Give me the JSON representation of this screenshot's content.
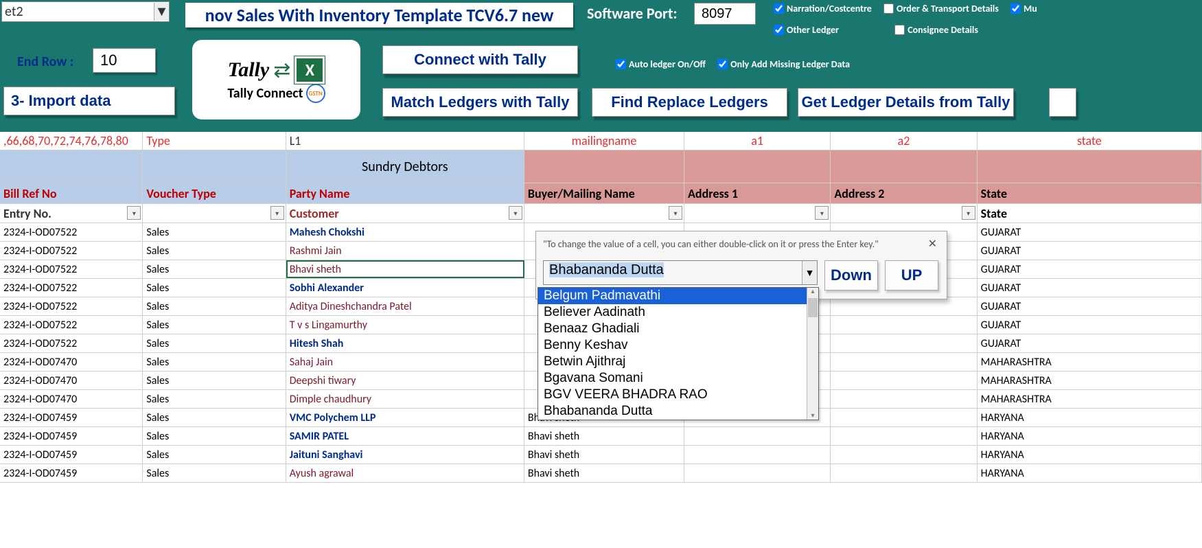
{
  "topCombo": "et2",
  "title": "nov Sales With Inventory Template TCV6.7 new",
  "softwarePortLabel": "Software Port:",
  "softwarePort": "8097",
  "checks": {
    "narration": {
      "label": "Narration/Costcentre",
      "checked": true
    },
    "order": {
      "label": "Order & Transport Details",
      "checked": false
    },
    "mu": {
      "label": "Mu",
      "checked": true
    },
    "otherLedger": {
      "label": "Other Ledger",
      "checked": true
    },
    "consignee": {
      "label": "Consignee Details",
      "checked": false
    },
    "autoLedger": {
      "label": "Auto ledger On/Off",
      "checked": true
    },
    "onlyAdd": {
      "label": "Only Add Missing Ledger Data",
      "checked": true
    }
  },
  "endRowLabel": "End Row :",
  "endRow": "10",
  "buttons": {
    "import": "3- Import data",
    "connect": "Connect  with Tally",
    "match": "Match Ledgers with Tally",
    "find": "Find Replace Ledgers",
    "getLedger": "Get Ledger Details from Tally"
  },
  "logo": {
    "l1": "Tally",
    "l2": "Tally Connect",
    "gst": "GSTN"
  },
  "headerRow1": {
    "colA": ",66,68,70,72,74,76,78,80",
    "colB": "Type",
    "colC": "L1",
    "colD": "mailingname",
    "colE": "a1",
    "colF": "a2",
    "colG": "state"
  },
  "headerRow2": {
    "colC": "Sundry Debtors"
  },
  "headerRow3": {
    "colA": "Bill Ref No",
    "colB": "Voucher Type",
    "colC": "Party Name",
    "colD": "Buyer/Mailing Name",
    "colE": "Address 1",
    "colF": "Address 2",
    "colG": "State"
  },
  "headerRow4": {
    "colA": "Entry No.",
    "colC": "Customer",
    "colG": "State"
  },
  "rows": [
    {
      "ref": "2324-I-OD07522",
      "vt": "Sales",
      "party": "Mahesh Chokshi",
      "style": "blue",
      "buyer": "",
      "state": "GUJARAT"
    },
    {
      "ref": "2324-I-OD07522",
      "vt": "Sales",
      "party": "Rashmi Jain",
      "style": "maroon",
      "buyer": "",
      "state": "GUJARAT"
    },
    {
      "ref": "2324-I-OD07522",
      "vt": "Sales",
      "party": "Bhavi sheth",
      "style": "maroon",
      "buyer": "",
      "state": "GUJARAT",
      "sel": true
    },
    {
      "ref": "2324-I-OD07522",
      "vt": "Sales",
      "party": "Sobhi Alexander",
      "style": "blue",
      "buyer": "",
      "state": "GUJARAT"
    },
    {
      "ref": "2324-I-OD07522",
      "vt": "Sales",
      "party": "Aditya Dineshchandra Patel",
      "style": "maroon",
      "buyer": "",
      "state": "GUJARAT"
    },
    {
      "ref": "2324-I-OD07522",
      "vt": "Sales",
      "party": "T v s Lingamurthy",
      "style": "maroon",
      "buyer": "",
      "state": "GUJARAT"
    },
    {
      "ref": "2324-I-OD07522",
      "vt": "Sales",
      "party": "Hitesh Shah",
      "style": "blue",
      "buyer": "",
      "state": "GUJARAT"
    },
    {
      "ref": "2324-I-OD07470",
      "vt": "Sales",
      "party": "Sahaj Jain",
      "style": "maroon",
      "buyer": "",
      "state": "MAHARASHTRA"
    },
    {
      "ref": "2324-I-OD07470",
      "vt": "Sales",
      "party": "Deepshi tiwary",
      "style": "maroon",
      "buyer": "",
      "state": "MAHARASHTRA"
    },
    {
      "ref": "2324-I-OD07470",
      "vt": "Sales",
      "party": "Dimple chaudhury",
      "style": "maroon",
      "buyer": "",
      "state": "MAHARASHTRA"
    },
    {
      "ref": "2324-I-OD07459",
      "vt": "Sales",
      "party": "VMC Polychem LLP",
      "style": "blue",
      "buyer": "Bhavi sheth",
      "state": "HARYANA"
    },
    {
      "ref": "2324-I-OD07459",
      "vt": "Sales",
      "party": "SAMIR PATEL",
      "style": "blue",
      "buyer": "Bhavi sheth",
      "state": "HARYANA"
    },
    {
      "ref": "2324-I-OD07459",
      "vt": "Sales",
      "party": "Jaituni Sanghavi",
      "style": "blue",
      "buyer": "Bhavi sheth",
      "state": "HARYANA"
    },
    {
      "ref": "2324-I-OD07459",
      "vt": "Sales",
      "party": "Ayush agrawal",
      "style": "maroon",
      "buyer": "Bhavi sheth",
      "state": "HARYANA"
    }
  ],
  "popup": {
    "hint": "\"To change the value of a cell, you can either double-click on it or press the Enter key.\"",
    "value": "Bhabananda Dutta",
    "down": "Down",
    "up": "UP"
  },
  "dropdown": [
    "Belgum Padmavathi",
    "Believer Aadinath",
    "Benaaz Ghadiali",
    "Benny Keshav",
    "Betwin  Ajithraj",
    "Bgavana Somani",
    "BGV VEERA BHADRA RAO",
    "Bhabananda Dutta"
  ]
}
